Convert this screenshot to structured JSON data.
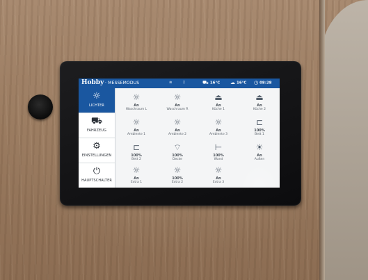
{
  "header": {
    "brand": "Hobby",
    "mode": "· MESSEMODUS",
    "wifi_icon": "wifi-icon",
    "bluetooth_icon": "bluetooth-icon",
    "outside_temp": "16°C",
    "inside_temp": "16°C",
    "time": "08:28"
  },
  "sidebar": {
    "items": [
      {
        "label": "LICHTER",
        "icon": "sun-icon"
      },
      {
        "label": "FAHRZEUG",
        "icon": "caravan-icon"
      },
      {
        "label": "EINSTELLUNGEN",
        "icon": "gears-icon"
      },
      {
        "label": "HAUPTSCHALTER",
        "icon": "power-icon"
      }
    ]
  },
  "tiles": [
    {
      "state": "An",
      "name": "Waschraum L",
      "icon": "sun-icon"
    },
    {
      "state": "An",
      "name": "Waschraum R",
      "icon": "sun-icon"
    },
    {
      "state": "An",
      "name": "Küche 1",
      "icon": "pot-icon"
    },
    {
      "state": "An",
      "name": "Küche 2",
      "icon": "pot-icon"
    },
    {
      "state": "An",
      "name": "Ambiente 1",
      "icon": "sun-icon"
    },
    {
      "state": "An",
      "name": "Ambiente 2",
      "icon": "sun-icon"
    },
    {
      "state": "An",
      "name": "Ambiente 3",
      "icon": "sun-icon"
    },
    {
      "state": "100%",
      "name": "Bett 1",
      "icon": "bed-icon"
    },
    {
      "state": "100%",
      "name": "Bett 2",
      "icon": "bed-icon"
    },
    {
      "state": "100%",
      "name": "Decke",
      "icon": "ceiling-light-icon"
    },
    {
      "state": "100%",
      "name": "Wand",
      "icon": "wall-light-icon"
    },
    {
      "state": "An",
      "name": "Außen",
      "icon": "outdoor-light-icon"
    },
    {
      "state": "An",
      "name": "Extra 1",
      "icon": "sun-icon"
    },
    {
      "state": "100%",
      "name": "Extra 2",
      "icon": "sun-icon"
    },
    {
      "state": "An",
      "name": "Extra 3",
      "icon": "sun-icon"
    }
  ]
}
